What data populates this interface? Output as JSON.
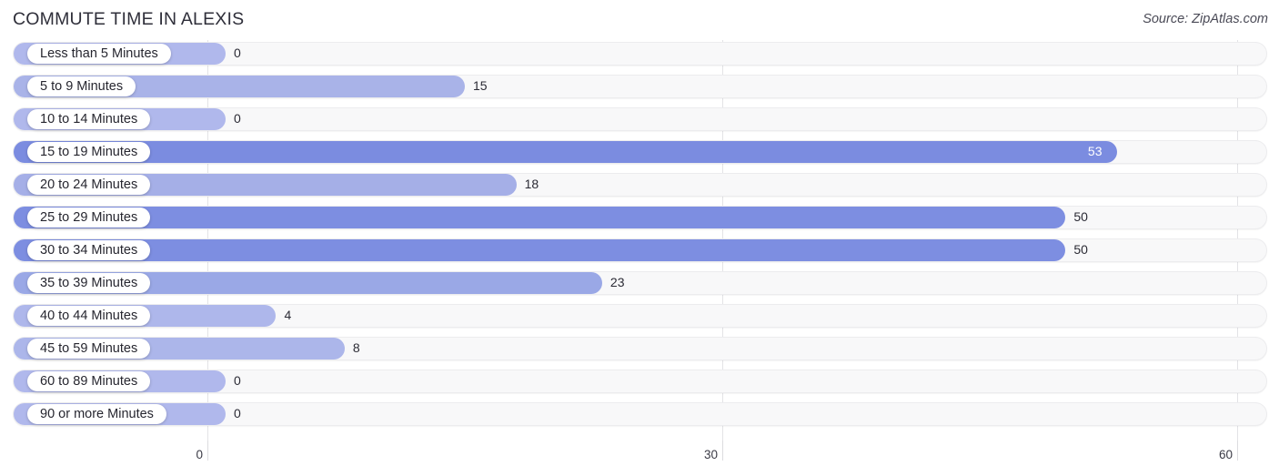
{
  "header": {
    "title": "COMMUTE TIME IN ALEXIS",
    "source": "Source: ZipAtlas.com"
  },
  "chart_data": {
    "type": "bar",
    "orientation": "horizontal",
    "title": "COMMUTE TIME IN ALEXIS",
    "xlabel": "",
    "ylabel": "",
    "xlim": [
      0,
      60
    ],
    "xticks": [
      0,
      30,
      60
    ],
    "xtick_labels": [
      "0",
      "30",
      "60"
    ],
    "grid": true,
    "legend": false,
    "categories": [
      "Less than 5 Minutes",
      "5 to 9 Minutes",
      "10 to 14 Minutes",
      "15 to 19 Minutes",
      "20 to 24 Minutes",
      "25 to 29 Minutes",
      "30 to 34 Minutes",
      "35 to 39 Minutes",
      "40 to 44 Minutes",
      "45 to 59 Minutes",
      "60 to 89 Minutes",
      "90 or more Minutes"
    ],
    "values": [
      0,
      15,
      0,
      53,
      18,
      50,
      50,
      23,
      4,
      8,
      0,
      0
    ],
    "value_labels": [
      "0",
      "15",
      "0",
      "53",
      "18",
      "50",
      "50",
      "23",
      "4",
      "8",
      "0",
      "0"
    ],
    "bar_colors": [
      "#b0b8ec",
      "#a9b3e8",
      "#b0b8ec",
      "#7b8ce0",
      "#a5afe7",
      "#7d8ee1",
      "#7d8ee1",
      "#9aa8e6",
      "#aeb7eb",
      "#acb6ea",
      "#b0b8ec",
      "#b0b8ec"
    ],
    "track_color": "#f8f8f9",
    "label_pill_color": "#ffffff"
  }
}
